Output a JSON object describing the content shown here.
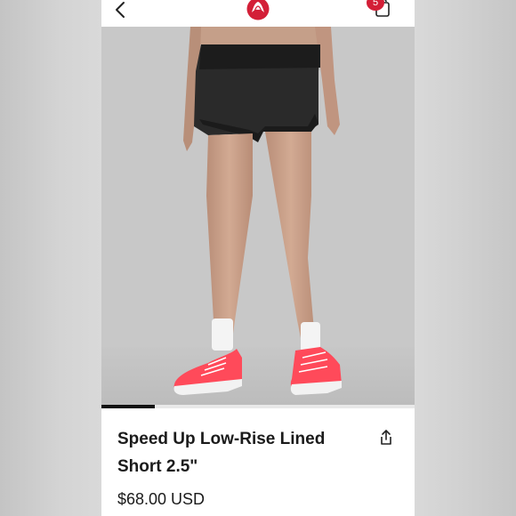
{
  "header": {
    "back_icon": "chevron-left-icon",
    "logo_icon": "lululemon-logo-icon",
    "bag_icon": "shopping-bag-icon",
    "bag_count": "5",
    "brand_color": "#d31f37"
  },
  "hero": {
    "image": "model-wearing-black-shorts-and-coral-running-shoes",
    "carousel_progress": 0.17
  },
  "product": {
    "title": "Speed Up Low-Rise Lined Short 2.5\"",
    "price": "$68.00 USD",
    "share_icon": "share-icon"
  }
}
